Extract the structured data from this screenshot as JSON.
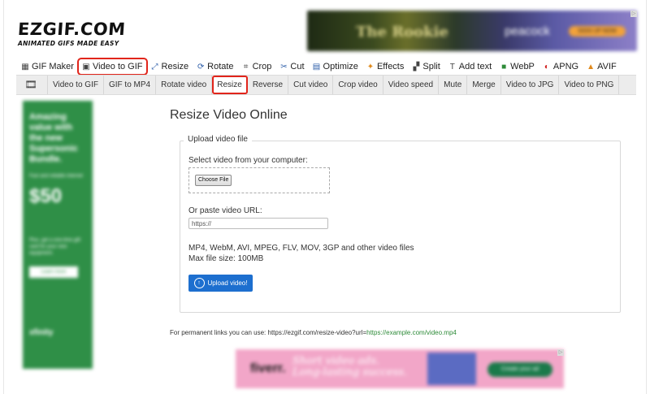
{
  "logo": {
    "main": "EZGIF.COM",
    "tagline": "ANIMATED GIFS MADE EASY"
  },
  "ads": {
    "top": {
      "title": "The Rookie",
      "brand": "peacock",
      "cta": "SIGN UP NOW"
    },
    "left": {
      "headline": "Amazing value with the new Supersonic Bundle.",
      "subline": "Fast and reliable internet",
      "price": "$50",
      "body": "Plus, get a one-time gift card for your new equipment.",
      "cta": "Learn more",
      "brand": "xfinity"
    },
    "bottom": {
      "brand": "fiverr.",
      "line1": "Short video ads.",
      "line2": "Long-lasting success.",
      "cta": "Create your ad"
    }
  },
  "main_nav": [
    {
      "label": "GIF Maker",
      "icon": "gif-icon"
    },
    {
      "label": "Video to GIF",
      "icon": "video-icon",
      "active": true
    },
    {
      "label": "Resize",
      "icon": "resize-icon"
    },
    {
      "label": "Rotate",
      "icon": "rotate-icon"
    },
    {
      "label": "Crop",
      "icon": "crop-icon"
    },
    {
      "label": "Cut",
      "icon": "cut-icon"
    },
    {
      "label": "Optimize",
      "icon": "optimize-icon"
    },
    {
      "label": "Effects",
      "icon": "effects-icon"
    },
    {
      "label": "Split",
      "icon": "split-icon"
    },
    {
      "label": "Add text",
      "icon": "text-icon"
    },
    {
      "label": "WebP",
      "icon": "webp-icon"
    },
    {
      "label": "APNG",
      "icon": "apng-icon"
    },
    {
      "label": "AVIF",
      "icon": "avif-icon"
    }
  ],
  "sub_nav": [
    {
      "label": "Video to GIF"
    },
    {
      "label": "GIF to MP4"
    },
    {
      "label": "Rotate video"
    },
    {
      "label": "Resize",
      "active": true
    },
    {
      "label": "Reverse"
    },
    {
      "label": "Cut video"
    },
    {
      "label": "Crop video"
    },
    {
      "label": "Video speed"
    },
    {
      "label": "Mute"
    },
    {
      "label": "Merge"
    },
    {
      "label": "Video to JPG"
    },
    {
      "label": "Video to PNG"
    }
  ],
  "page": {
    "title": "Resize Video Online",
    "fieldset_legend": "Upload video file",
    "select_label": "Select video from your computer:",
    "choose_file": "Choose File",
    "url_label": "Or paste video URL:",
    "url_value": "https://",
    "formats": "MP4, WebM, AVI, MPEG, FLV, MOV, 3GP and other video files",
    "max_size": "Max file size: 100MB",
    "upload_button": "Upload video!",
    "permanent_prefix": "For permanent links you can use: https://ezgif.com/resize-video?url=",
    "permanent_example": "https://example.com/video.mp4"
  },
  "colors": {
    "active_outline": "#e1251b",
    "upload_button": "#1d6fcf",
    "link": "#2e8b39"
  }
}
